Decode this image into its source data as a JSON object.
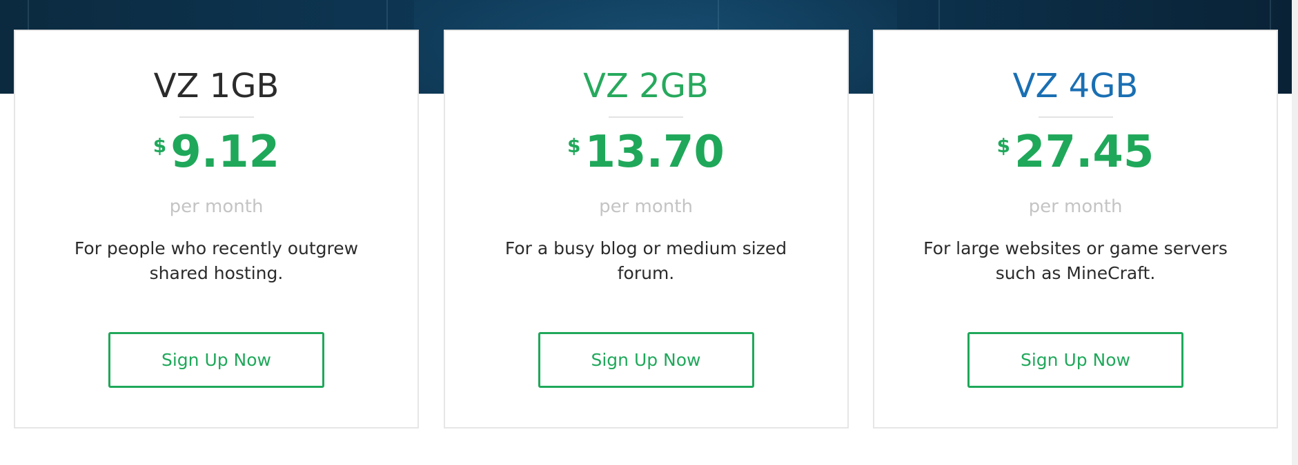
{
  "colors": {
    "accent_green": "#1fa85a",
    "plan1_title": "#2b2b2b",
    "plan2_title": "#27a95d",
    "plan3_title": "#1a6fb3",
    "muted_text": "#c4c4c4",
    "hero_band": "#0d3552"
  },
  "plans": [
    {
      "name": "VZ 1GB",
      "currency": "$",
      "price": "9.12",
      "period": "per month",
      "description": "For people who recently outgrew shared hosting.",
      "cta": "Sign Up Now"
    },
    {
      "name": "VZ 2GB",
      "currency": "$",
      "price": "13.70",
      "period": "per month",
      "description": "For a busy blog or medium sized forum.",
      "cta": "Sign Up Now"
    },
    {
      "name": "VZ 4GB",
      "currency": "$",
      "price": "27.45",
      "period": "per month",
      "description": "For large websites or game servers such as MineCraft.",
      "cta": "Sign Up Now"
    }
  ]
}
